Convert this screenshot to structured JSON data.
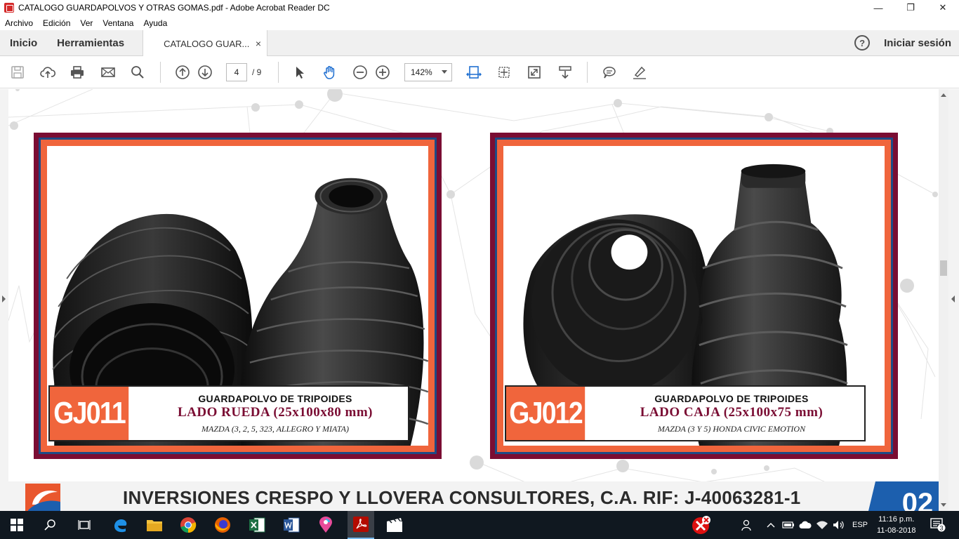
{
  "window": {
    "title": "CATALOGO GUARDAPOLVOS Y OTRAS GOMAS.pdf - Adobe Acrobat Reader DC",
    "minimize": "—",
    "restore": "❐",
    "close": "✕"
  },
  "menu": [
    "Archivo",
    "Edición",
    "Ver",
    "Ventana",
    "Ayuda"
  ],
  "tabs": {
    "home": "Inicio",
    "tools": "Herramientas",
    "document": "CATALOGO GUAR...",
    "close": "×",
    "help": "?",
    "signin": "Iniciar sesión"
  },
  "toolbar": {
    "page_current": "4",
    "page_total": "/  9",
    "zoom": "142%"
  },
  "products": [
    {
      "code": "GJ011",
      "line1": "GUARDAPOLVO DE TRIPOIDES",
      "line2": "LADO RUEDA (25x100x80 mm)",
      "line3": "MAZDA (3, 2, 5, 323, ALLEGRO Y MIATA)"
    },
    {
      "code": "GJ012",
      "line1": "GUARDAPOLVO DE TRIPOIDES",
      "line2": "LADO CAJA (25x100x75 mm)",
      "line3": "MAZDA (3 Y 5) HONDA CIVIC EMOTION"
    }
  ],
  "footer": {
    "company": "INVERSIONES CRESPO Y LLOVERA CONSULTORES, C.A. RIF: J-40063281-1",
    "page_number": "02"
  },
  "taskbar": {
    "time": "11:16 p.m.",
    "date": "11-08-2018",
    "language": "ESP",
    "notifications": "3"
  },
  "colors": {
    "frame_outer": "#7a0d33",
    "frame_mid": "#1d4a86",
    "frame_inner": "#f0653c",
    "accent_text": "#7a0d33"
  }
}
